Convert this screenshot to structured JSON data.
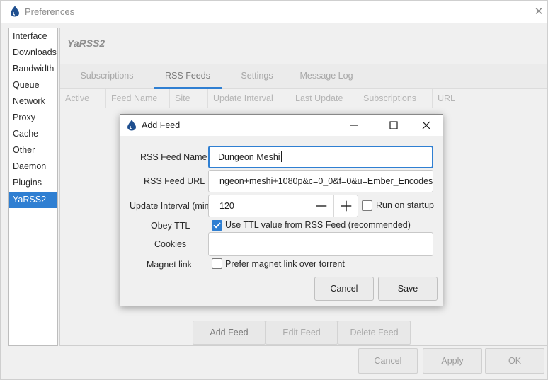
{
  "window": {
    "title": "Preferences",
    "close_symbol": "✕"
  },
  "sidebar": {
    "items": [
      {
        "label": "Interface",
        "selected": false
      },
      {
        "label": "Downloads",
        "selected": false
      },
      {
        "label": "Bandwidth",
        "selected": false
      },
      {
        "label": "Queue",
        "selected": false
      },
      {
        "label": "Network",
        "selected": false
      },
      {
        "label": "Proxy",
        "selected": false
      },
      {
        "label": "Cache",
        "selected": false
      },
      {
        "label": "Other",
        "selected": false
      },
      {
        "label": "Daemon",
        "selected": false
      },
      {
        "label": "Plugins",
        "selected": false
      },
      {
        "label": "YaRSS2",
        "selected": true
      }
    ]
  },
  "plugin": {
    "title": "YaRSS2",
    "tabs": [
      {
        "label": "Subscriptions",
        "active": false
      },
      {
        "label": "RSS Feeds",
        "active": true
      },
      {
        "label": "Settings",
        "active": false
      },
      {
        "label": "Message Log",
        "active": false
      }
    ],
    "columns": [
      "Active",
      "Feed Name",
      "Site",
      "Update Interval",
      "Last Update",
      "Subscriptions",
      "URL"
    ],
    "buttons": {
      "add_feed": "Add Feed",
      "edit_feed": "Edit Feed",
      "delete_feed": "Delete Feed"
    }
  },
  "footer": {
    "cancel": "Cancel",
    "apply": "Apply",
    "ok": "OK"
  },
  "dialog": {
    "title": "Add Feed",
    "fields": {
      "name_label": "RSS Feed Name",
      "name_value": "Dungeon Meshi",
      "url_label": "RSS Feed URL",
      "url_value": "ngeon+meshi+1080p&c=0_0&f=0&u=Ember_Encodes",
      "interval_label": "Update Interval (min)",
      "interval_value": "120",
      "run_on_startup_label": "Run on startup",
      "run_on_startup_checked": false,
      "obey_ttl_label": "Obey TTL",
      "obey_ttl_option": "Use TTL value from RSS Feed (recommended)",
      "obey_ttl_checked": true,
      "cookies_label": "Cookies",
      "cookies_value": "",
      "magnet_label": "Magnet link",
      "magnet_option": "Prefer magnet link over torrent",
      "magnet_checked": false
    },
    "buttons": {
      "cancel": "Cancel",
      "save": "Save"
    }
  },
  "colors": {
    "accent": "#2f7fd2",
    "deluge_drop": "#1f4f8f"
  },
  "icons": {
    "app": "deluge-drop-icon",
    "close": "close-icon",
    "minimize": "minimize-icon",
    "maximize": "maximize-icon",
    "spin_decrement": "minus-icon",
    "spin_increment": "plus-icon",
    "checkmark": "checkmark-icon"
  }
}
